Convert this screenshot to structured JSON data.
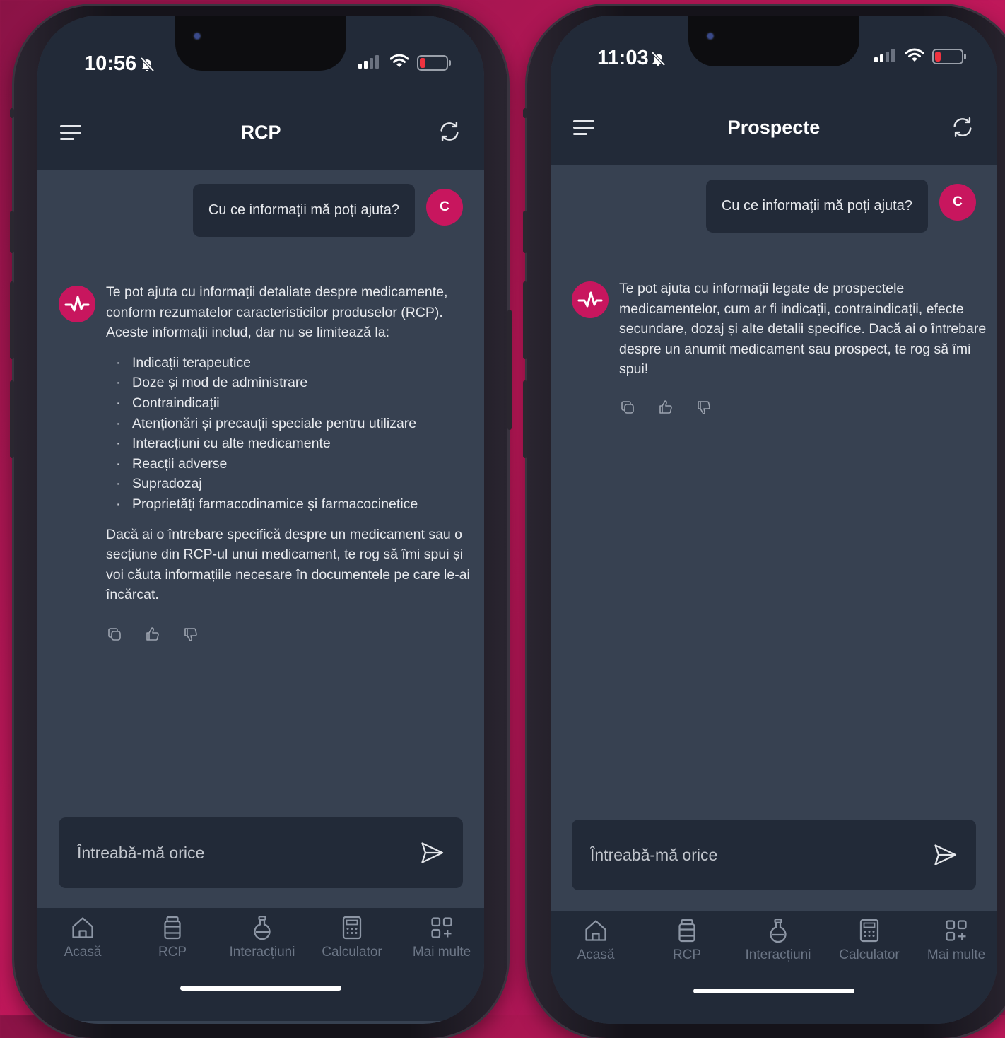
{
  "colors": {
    "accent": "#c8165e",
    "header_bg": "#222a38",
    "screen_bg": "#374151"
  },
  "screens": [
    {
      "status_bar": {
        "time": "10:56"
      },
      "header": {
        "title": "RCP",
        "menu_icon": "hamburger-menu-icon",
        "refresh_icon": "refresh-icon"
      },
      "user_message": {
        "text": "Cu ce informații mă poți ajuta?",
        "avatar_initial": "C"
      },
      "bot_message": {
        "intro": "Te pot ajuta cu informații detaliate despre medicamente, conform rezumatelor caracteristicilor produselor (RCP). Aceste informații includ, dar nu se limitează la:",
        "items": [
          "Indicații terapeutice",
          "Doze și mod de administrare",
          "Contraindicații",
          "Atenționări și precauții speciale pentru utilizare",
          "Interacțiuni cu alte medicamente",
          "Reacții adverse",
          "Supradozaj",
          "Proprietăți farmacodinamice și farmacocinetice"
        ],
        "outro": "Dacă ai o întrebare specifică despre un medicament sau o secțiune din RCP-ul unui medicament, te rog să îmi spui și voi căuta informațiile necesare în documentele pe care le-ai încărcat."
      },
      "composer": {
        "placeholder": "Întreabă-mă orice"
      },
      "tabs": [
        {
          "label": "Acasă",
          "icon": "home-icon"
        },
        {
          "label": "RCP",
          "icon": "bottle-icon"
        },
        {
          "label": "Interacțiuni",
          "icon": "flask-icon"
        },
        {
          "label": "Calculator",
          "icon": "calculator-icon"
        },
        {
          "label": "Mai multe",
          "icon": "grid-plus-icon"
        }
      ]
    },
    {
      "status_bar": {
        "time": "11:03"
      },
      "header": {
        "title": "Prospecte",
        "menu_icon": "hamburger-menu-icon",
        "refresh_icon": "refresh-icon"
      },
      "user_message": {
        "text": "Cu ce informații mă poți ajuta?",
        "avatar_initial": "C"
      },
      "bot_message": {
        "intro": "Te pot ajuta cu informații legate de prospectele medicamentelor, cum ar fi indicații, contraindicații, efecte secundare, dozaj și alte detalii specifice. Dacă ai o întrebare despre un anumit medicament sau prospect, te rog să îmi spui!"
      },
      "composer": {
        "placeholder": "Întreabă-mă orice"
      },
      "tabs": [
        {
          "label": "Acasă",
          "icon": "home-icon"
        },
        {
          "label": "RCP",
          "icon": "bottle-icon"
        },
        {
          "label": "Interacțiuni",
          "icon": "flask-icon"
        },
        {
          "label": "Calculator",
          "icon": "calculator-icon"
        },
        {
          "label": "Mai multe",
          "icon": "grid-plus-icon"
        }
      ]
    }
  ]
}
